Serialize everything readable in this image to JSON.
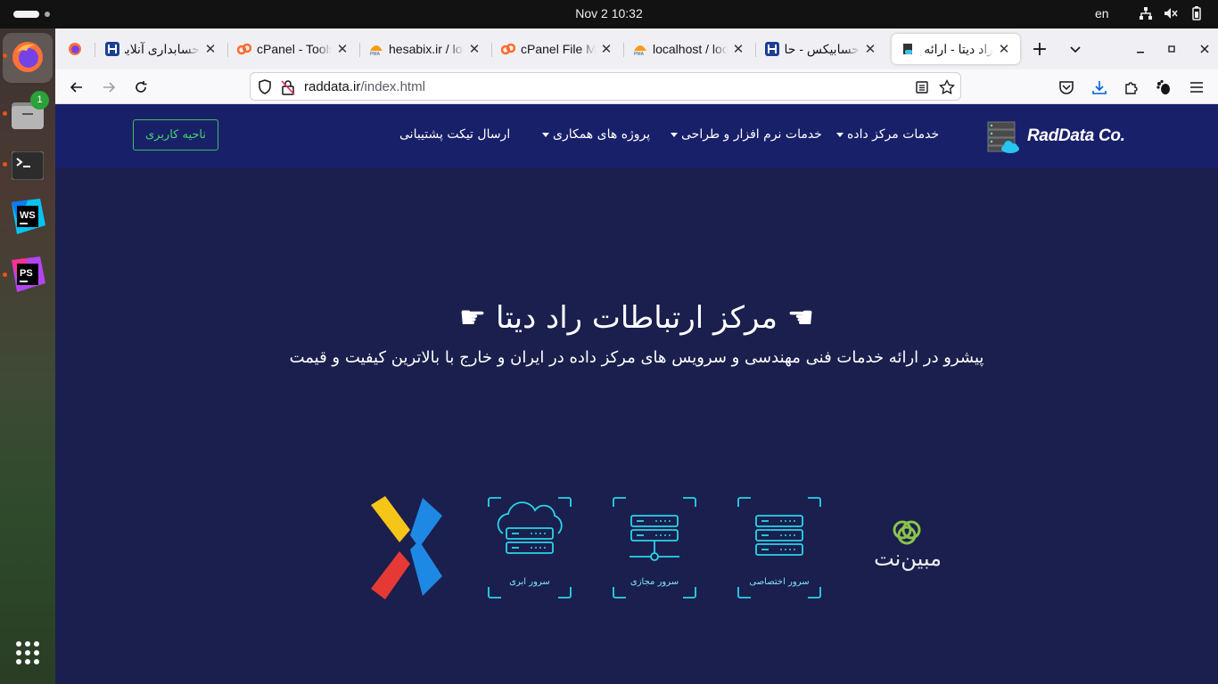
{
  "system": {
    "clock": "Nov 2  10:32",
    "language": "en"
  },
  "dock": {
    "files_badge": "1",
    "apps": [
      "firefox-icon",
      "files-icon",
      "terminal-icon",
      "webstorm-icon",
      "phpstorm-icon",
      "app-grid-icon"
    ]
  },
  "browser": {
    "tabs": [
      {
        "title": "",
        "icon": "firefox-tab-icon"
      },
      {
        "title": "حسابداری آنلاین",
        "icon": "hesabix-icon"
      },
      {
        "title": "cPanel - Tools",
        "icon": "cpanel-icon"
      },
      {
        "title": "hesabix.ir / loc",
        "icon": "phpmyadmin-icon"
      },
      {
        "title": "cPanel File Ma",
        "icon": "cpanel-icon"
      },
      {
        "title": "localhost / loc",
        "icon": "phpmyadmin-icon"
      },
      {
        "title": "حسابیکس - حا",
        "icon": "hesabix-icon"
      },
      {
        "title": "راد دیتا - ارائه خ",
        "icon": "raddata-icon",
        "active": true
      }
    ],
    "url_host": "raddata.ir",
    "url_path": "/index.html"
  },
  "site": {
    "brand": "RadData Co.",
    "nav": {
      "datacenter": "خدمات مرکز داده",
      "software": "خدمات نرم افزار و طراحی",
      "partner": "پروژه های همکاری",
      "ticket": "ارسال تیکت پشتیبانی"
    },
    "login": "ناحیه کاربری",
    "hero_title": "☚ مرکز ارتباطات راد دیتا ☛",
    "hero_subtitle": "پیشرو در ارائه خدمات فنی مهندسی و سرویس های مرکز داده در ایران و خارج با بالاترین کیفیت و قیمت",
    "services": {
      "cloud": "سرور ابری",
      "virtual": "سرور مجازی",
      "dedicated": "سرور اختصاصی"
    },
    "partner_logo_text": "مبین‌نت",
    "colors": {
      "nav_bg": "#19206a",
      "hero_bg": "#1a1f4d",
      "accent_green": "#46d36a",
      "accent_cyan": "#7fe7f5"
    }
  }
}
